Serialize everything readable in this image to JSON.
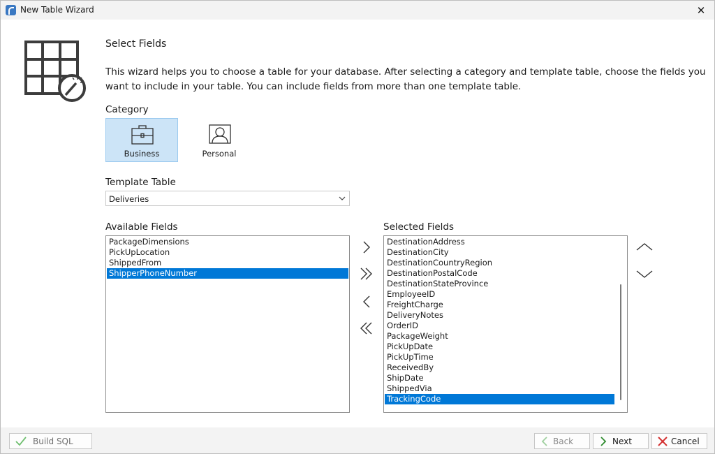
{
  "window": {
    "title": "New Table Wizard",
    "close_icon": "close-icon"
  },
  "page": {
    "heading": "Select Fields",
    "description": "This wizard helps you to choose a table for your database. After selecting a category and template table, choose the fields you want to include in your table. You can include fields from more than one template table."
  },
  "category": {
    "label": "Category",
    "options": [
      {
        "label": "Business",
        "icon": "briefcase-icon",
        "selected": true
      },
      {
        "label": "Personal",
        "icon": "person-icon",
        "selected": false
      }
    ]
  },
  "template_table": {
    "label": "Template Table",
    "value": "Deliveries"
  },
  "available_fields": {
    "label": "Available Fields",
    "items": [
      "PackageDimensions",
      "PickUpLocation",
      "ShippedFrom",
      "ShipperPhoneNumber"
    ],
    "selected_index": 3
  },
  "selected_fields": {
    "label": "Selected Fields",
    "items": [
      "DestinationAddress",
      "DestinationCity",
      "DestinationCountryRegion",
      "DestinationPostalCode",
      "DestinationStateProvince",
      "EmployeeID",
      "FreightCharge",
      "DeliveryNotes",
      "OrderID",
      "PackageWeight",
      "PickUpDate",
      "PickUpTime",
      "ReceivedBy",
      "ShipDate",
      "ShippedVia",
      "TrackingCode"
    ],
    "selected_index": 15
  },
  "footer": {
    "build_sql_label": "Build SQL",
    "back_label": "Back",
    "next_label": "Next",
    "cancel_label": "Cancel"
  },
  "colors": {
    "accent": "#0078d7",
    "category_selected_bg": "#cce4f7",
    "next_arrow": "#2e8b2e",
    "cancel_x": "#d32f2f",
    "build_check": "#6fbf6f"
  }
}
